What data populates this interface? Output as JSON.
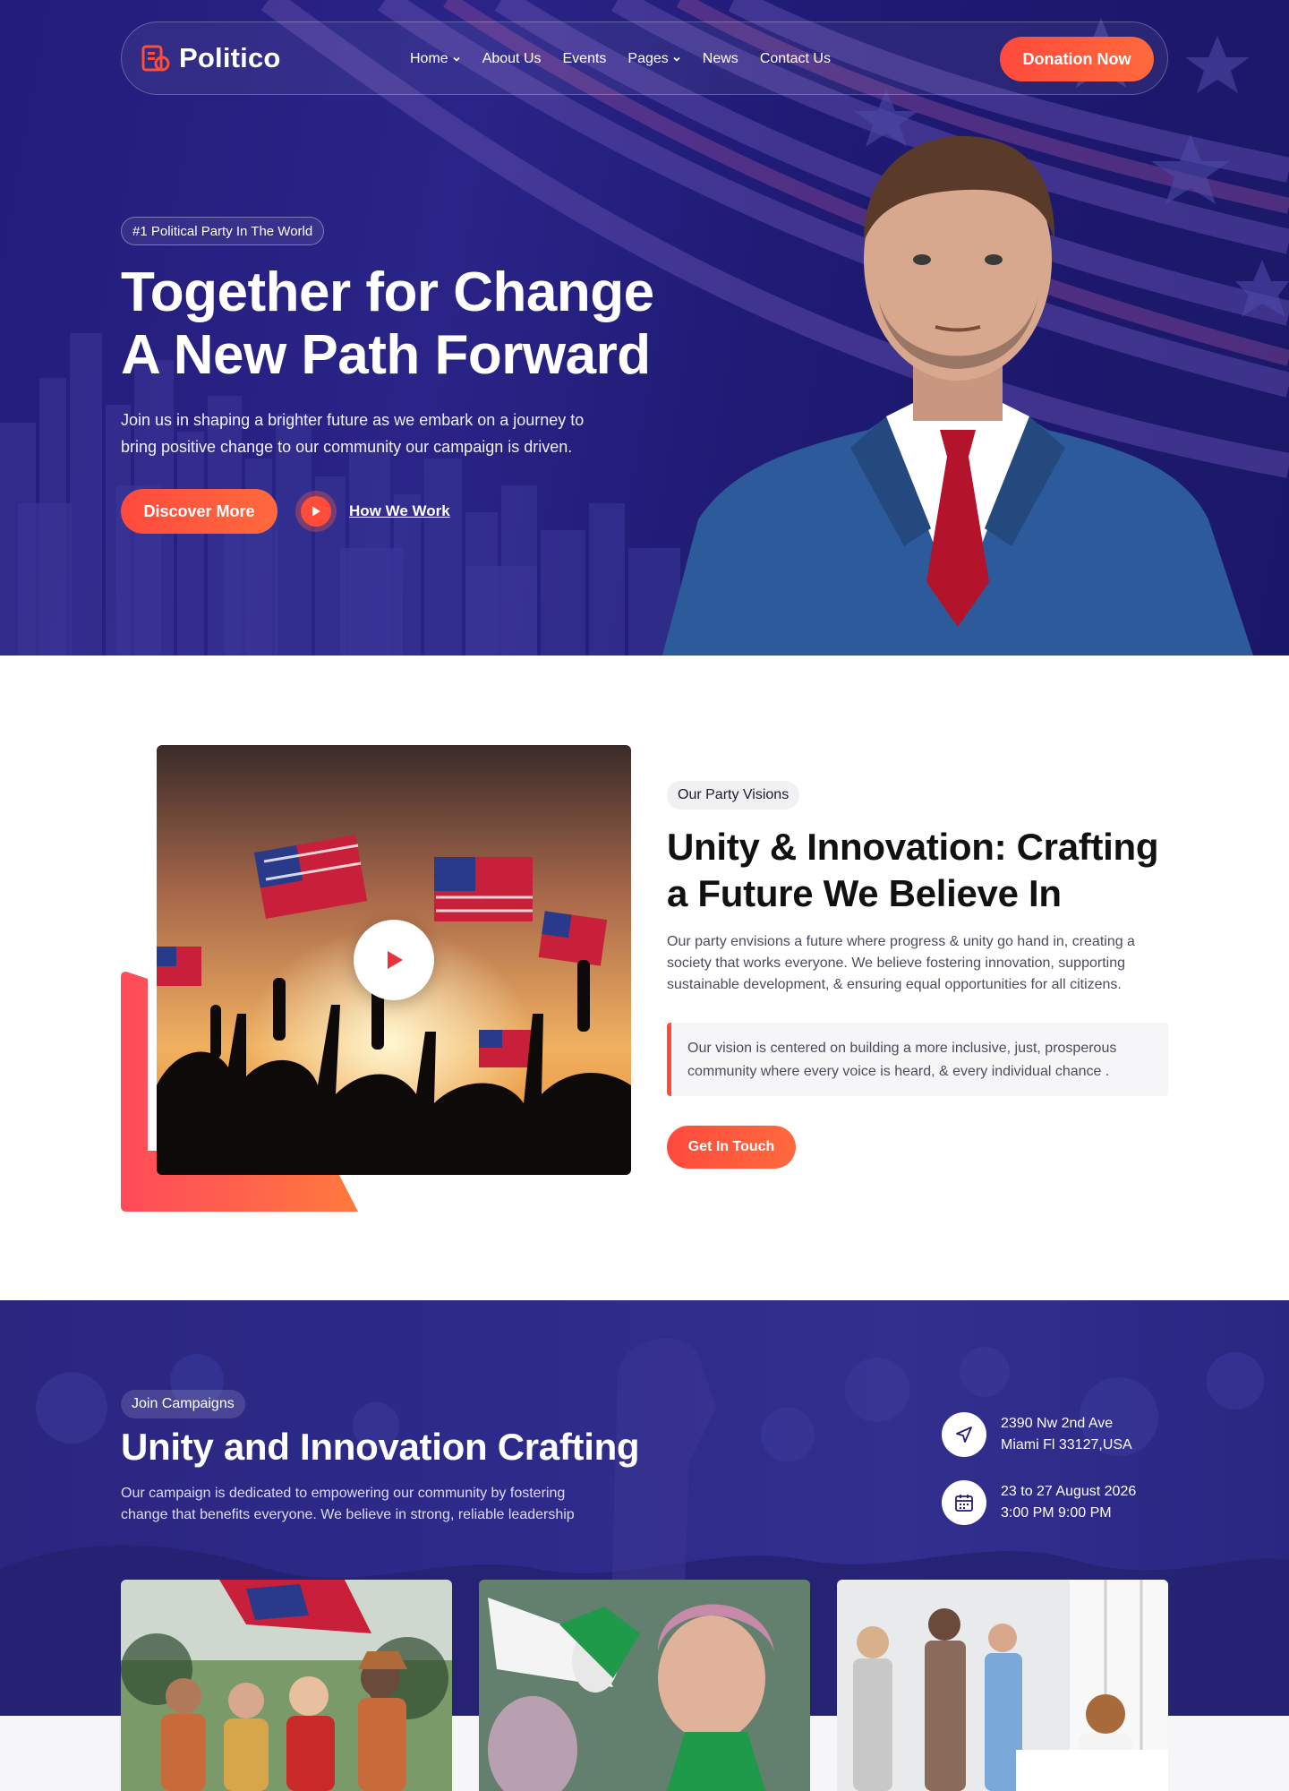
{
  "brand": {
    "name": "Politico",
    "accent": "#ff4d3a",
    "navy": "#241c7a"
  },
  "nav": {
    "items": [
      {
        "label": "Home",
        "has_dropdown": true
      },
      {
        "label": "About Us",
        "has_dropdown": false
      },
      {
        "label": "Events",
        "has_dropdown": false
      },
      {
        "label": "Pages",
        "has_dropdown": true
      },
      {
        "label": "News",
        "has_dropdown": false
      },
      {
        "label": "Contact Us",
        "has_dropdown": false
      }
    ],
    "cta": "Donation Now"
  },
  "hero": {
    "badge": "#1 Political Party In The World",
    "title_line1": "Together for Change",
    "title_line2": "A New Path Forward",
    "subtitle_line1": "Join us in shaping a brighter future as we embark on a journey to",
    "subtitle_line2": "bring positive change to our community our campaign is driven.",
    "primary_button": "Discover More",
    "video_link": "How We Work"
  },
  "vision": {
    "tag": "Our Party Visions",
    "title_line1": "Unity & Innovation: Crafting",
    "title_line2": "a Future We Believe In",
    "text_line1": "Our party envisions a future where progress & unity go hand in, creating a",
    "text_line2": "society that works everyone. We believe fostering innovation, supporting",
    "text_line3": "sustainable development, & ensuring equal opportunities for all citizens.",
    "quote_line1": "Our vision is centered on building a more inclusive, just, prosperous",
    "quote_line2": "community where every voice is heard, & every individual chance .",
    "button": "Get In Touch"
  },
  "campaigns": {
    "tag": "Join Campaigns",
    "title": "Unity and Innovation Crafting",
    "text_line1": "Our campaign is dedicated to empowering our community by fostering",
    "text_line2": "change that benefits everyone. We believe in strong, reliable leadership",
    "location_line1": "2390 Nw 2nd Ave",
    "location_line2": "Miami Fl 33127,USA",
    "date_line1": "23 to 27 August 2026",
    "date_line2": "3:00 PM 9:00 PM"
  }
}
